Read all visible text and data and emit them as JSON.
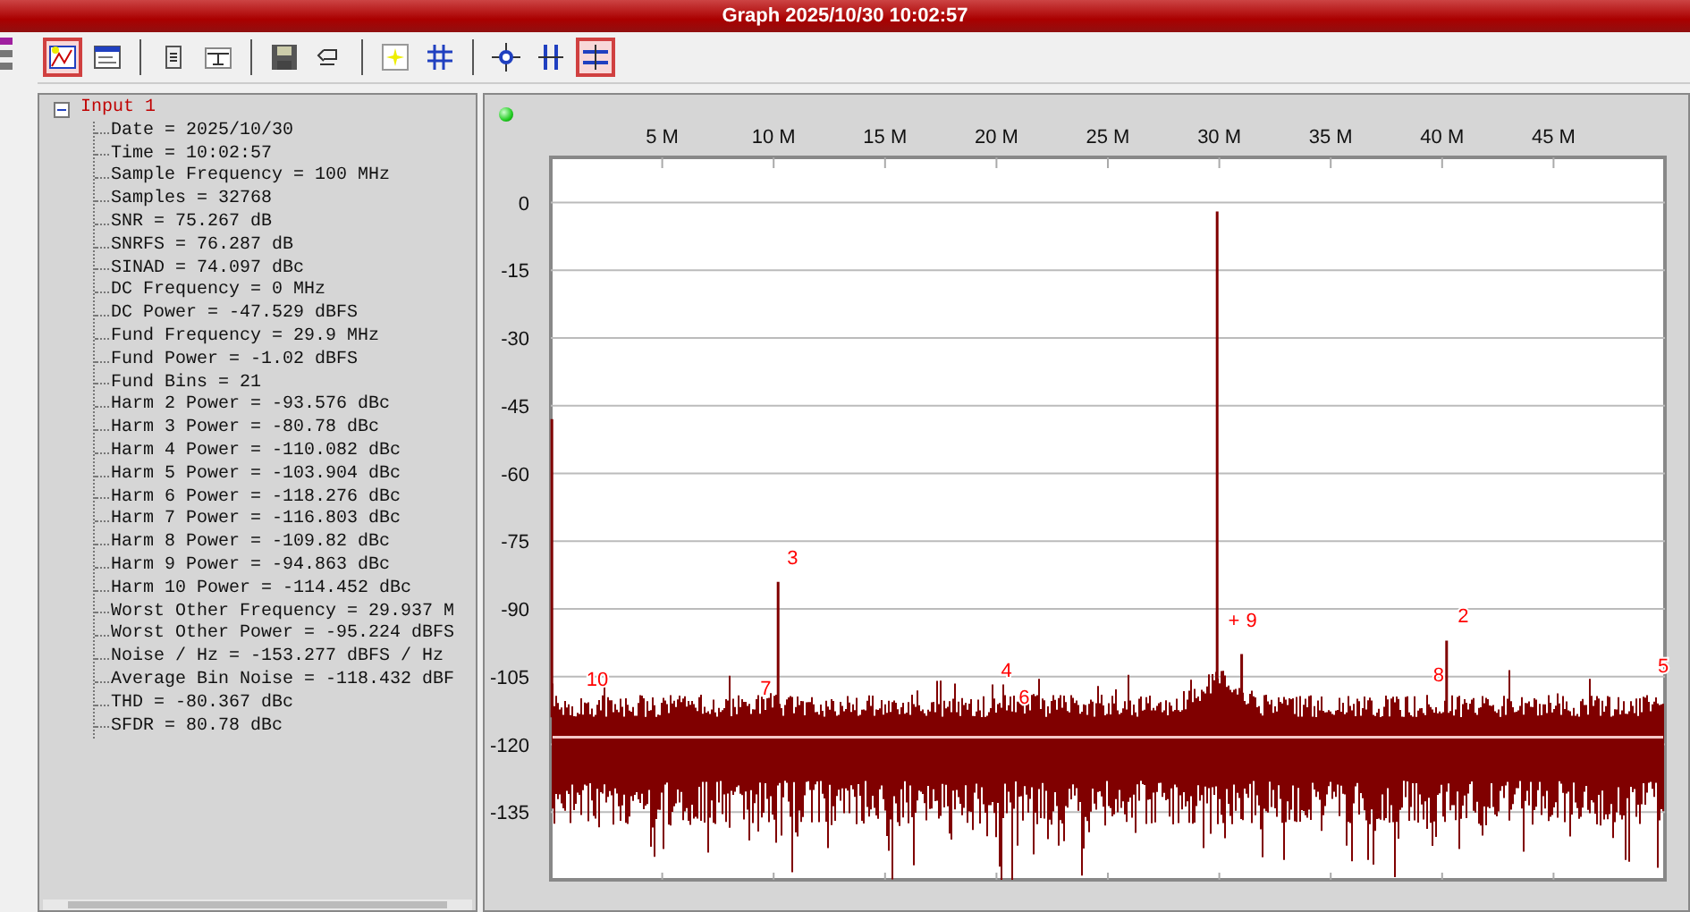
{
  "window": {
    "title": "Graph 2025/10/30 10:02:57"
  },
  "toolbar": [
    {
      "kind": "button",
      "selected": true
    },
    {
      "kind": "button",
      "selected": false
    },
    {
      "kind": "separator"
    },
    {
      "kind": "button",
      "selected": false
    },
    {
      "kind": "button",
      "selected": false
    },
    {
      "kind": "separator"
    },
    {
      "kind": "button",
      "selected": false
    },
    {
      "kind": "button",
      "selected": false
    },
    {
      "kind": "separator"
    },
    {
      "kind": "button",
      "selected": false
    },
    {
      "kind": "button",
      "selected": false
    },
    {
      "kind": "separator"
    },
    {
      "kind": "button",
      "selected": false
    },
    {
      "kind": "button",
      "selected": false
    },
    {
      "kind": "button",
      "selected": true
    }
  ],
  "tree": {
    "label": "Input 1",
    "expanded": true,
    "children": [
      {
        "label": "Date = 2025/10/30"
      },
      {
        "label": "Time = 10:02:57"
      },
      {
        "label": "Sample Frequency = 100 MHz"
      },
      {
        "label": "Samples = 32768"
      },
      {
        "label": "SNR = 75.267 dB"
      },
      {
        "label": "SNRFS = 76.287 dB"
      },
      {
        "label": "SINAD = 74.097 dBc"
      },
      {
        "label": "DC Frequency = 0 MHz"
      },
      {
        "label": "DC Power = -47.529 dBFS"
      },
      {
        "label": "Fund Frequency = 29.9 MHz"
      },
      {
        "label": "Fund Power = -1.02 dBFS"
      },
      {
        "label": "Fund Bins = 21"
      },
      {
        "label": "Harm 2 Power = -93.576 dBc"
      },
      {
        "label": "Harm 3 Power = -80.78 dBc"
      },
      {
        "label": "Harm 4 Power = -110.082 dBc"
      },
      {
        "label": "Harm 5 Power = -103.904 dBc"
      },
      {
        "label": "Harm 6 Power = -118.276 dBc"
      },
      {
        "label": "Harm 7 Power = -116.803 dBc"
      },
      {
        "label": "Harm 8 Power = -109.82 dBc"
      },
      {
        "label": "Harm 9 Power = -94.863 dBc"
      },
      {
        "label": "Harm 10 Power = -114.452 dBc"
      },
      {
        "label": "Worst Other Frequency = 29.937 M"
      },
      {
        "label": "Worst Other Power = -95.224 dBFS"
      },
      {
        "label": "Noise / Hz = -153.277 dBFS / Hz"
      },
      {
        "label": "Average Bin Noise = -118.432 dBF"
      },
      {
        "label": "THD = -80.367 dBc"
      },
      {
        "label": "SFDR = 80.78 dBc"
      }
    ]
  },
  "graph": {
    "status_on": true,
    "x_labels": [
      "5 M",
      "10 M",
      "15 M",
      "20 M",
      "25 M",
      "30 M",
      "35 M",
      "40 M",
      "45 M"
    ],
    "y_labels": [
      "0",
      "-15",
      "-30",
      "-45",
      "-60",
      "-75",
      "-90",
      "-105",
      "-120",
      "-135"
    ],
    "markers": [
      "10",
      "3",
      "7",
      "4",
      "6",
      "+",
      "9",
      "2",
      "8",
      "5"
    ]
  }
}
